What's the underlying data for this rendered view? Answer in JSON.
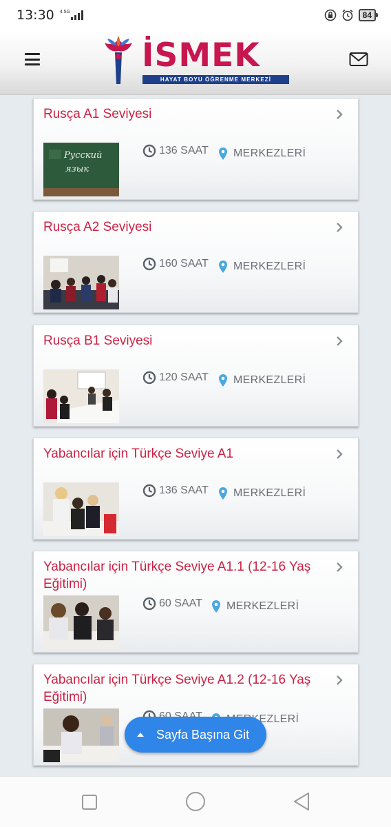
{
  "status_bar": {
    "time": "13:30",
    "network_label": "4.5G",
    "battery": "84"
  },
  "header": {
    "logo_text": "İSMEK",
    "logo_tagline": "HAYAT BOYU ÖĞRENME MERKEZİ",
    "menu_icon": "hamburger-icon",
    "mail_icon": "envelope-icon"
  },
  "courses": [
    {
      "title": "Rusça A1 Seviyesi",
      "hours": "136 SAAT",
      "centers": "MERKEZLERİ"
    },
    {
      "title": "Rusça A2 Seviyesi",
      "hours": "160 SAAT",
      "centers": "MERKEZLERİ"
    },
    {
      "title": "Rusça B1 Seviyesi",
      "hours": "120 SAAT",
      "centers": "MERKEZLERİ"
    },
    {
      "title": "Yabancılar için Türkçe Seviye A1",
      "hours": "136 SAAT",
      "centers": "MERKEZLERİ"
    },
    {
      "title": "Yabancılar için Türkçe Seviye A1.1 (12-16 Yaş Eğitimi)",
      "hours": "60 SAAT",
      "centers": "MERKEZLERİ"
    },
    {
      "title": "Yabancılar için Türkçe Seviye A1.2 (12-16 Yaş Eğitimi)",
      "hours": "60 SAAT",
      "centers": "MERKEZLERİ"
    }
  ],
  "thumb_text": {
    "line1": "Русский",
    "line2": "язык"
  },
  "scroll_top_button": {
    "label": "Sayfa Başına Git"
  },
  "colors": {
    "accent": "#cc2244",
    "button": "#2f86e8",
    "logo_blue": "#1e3f8a"
  }
}
